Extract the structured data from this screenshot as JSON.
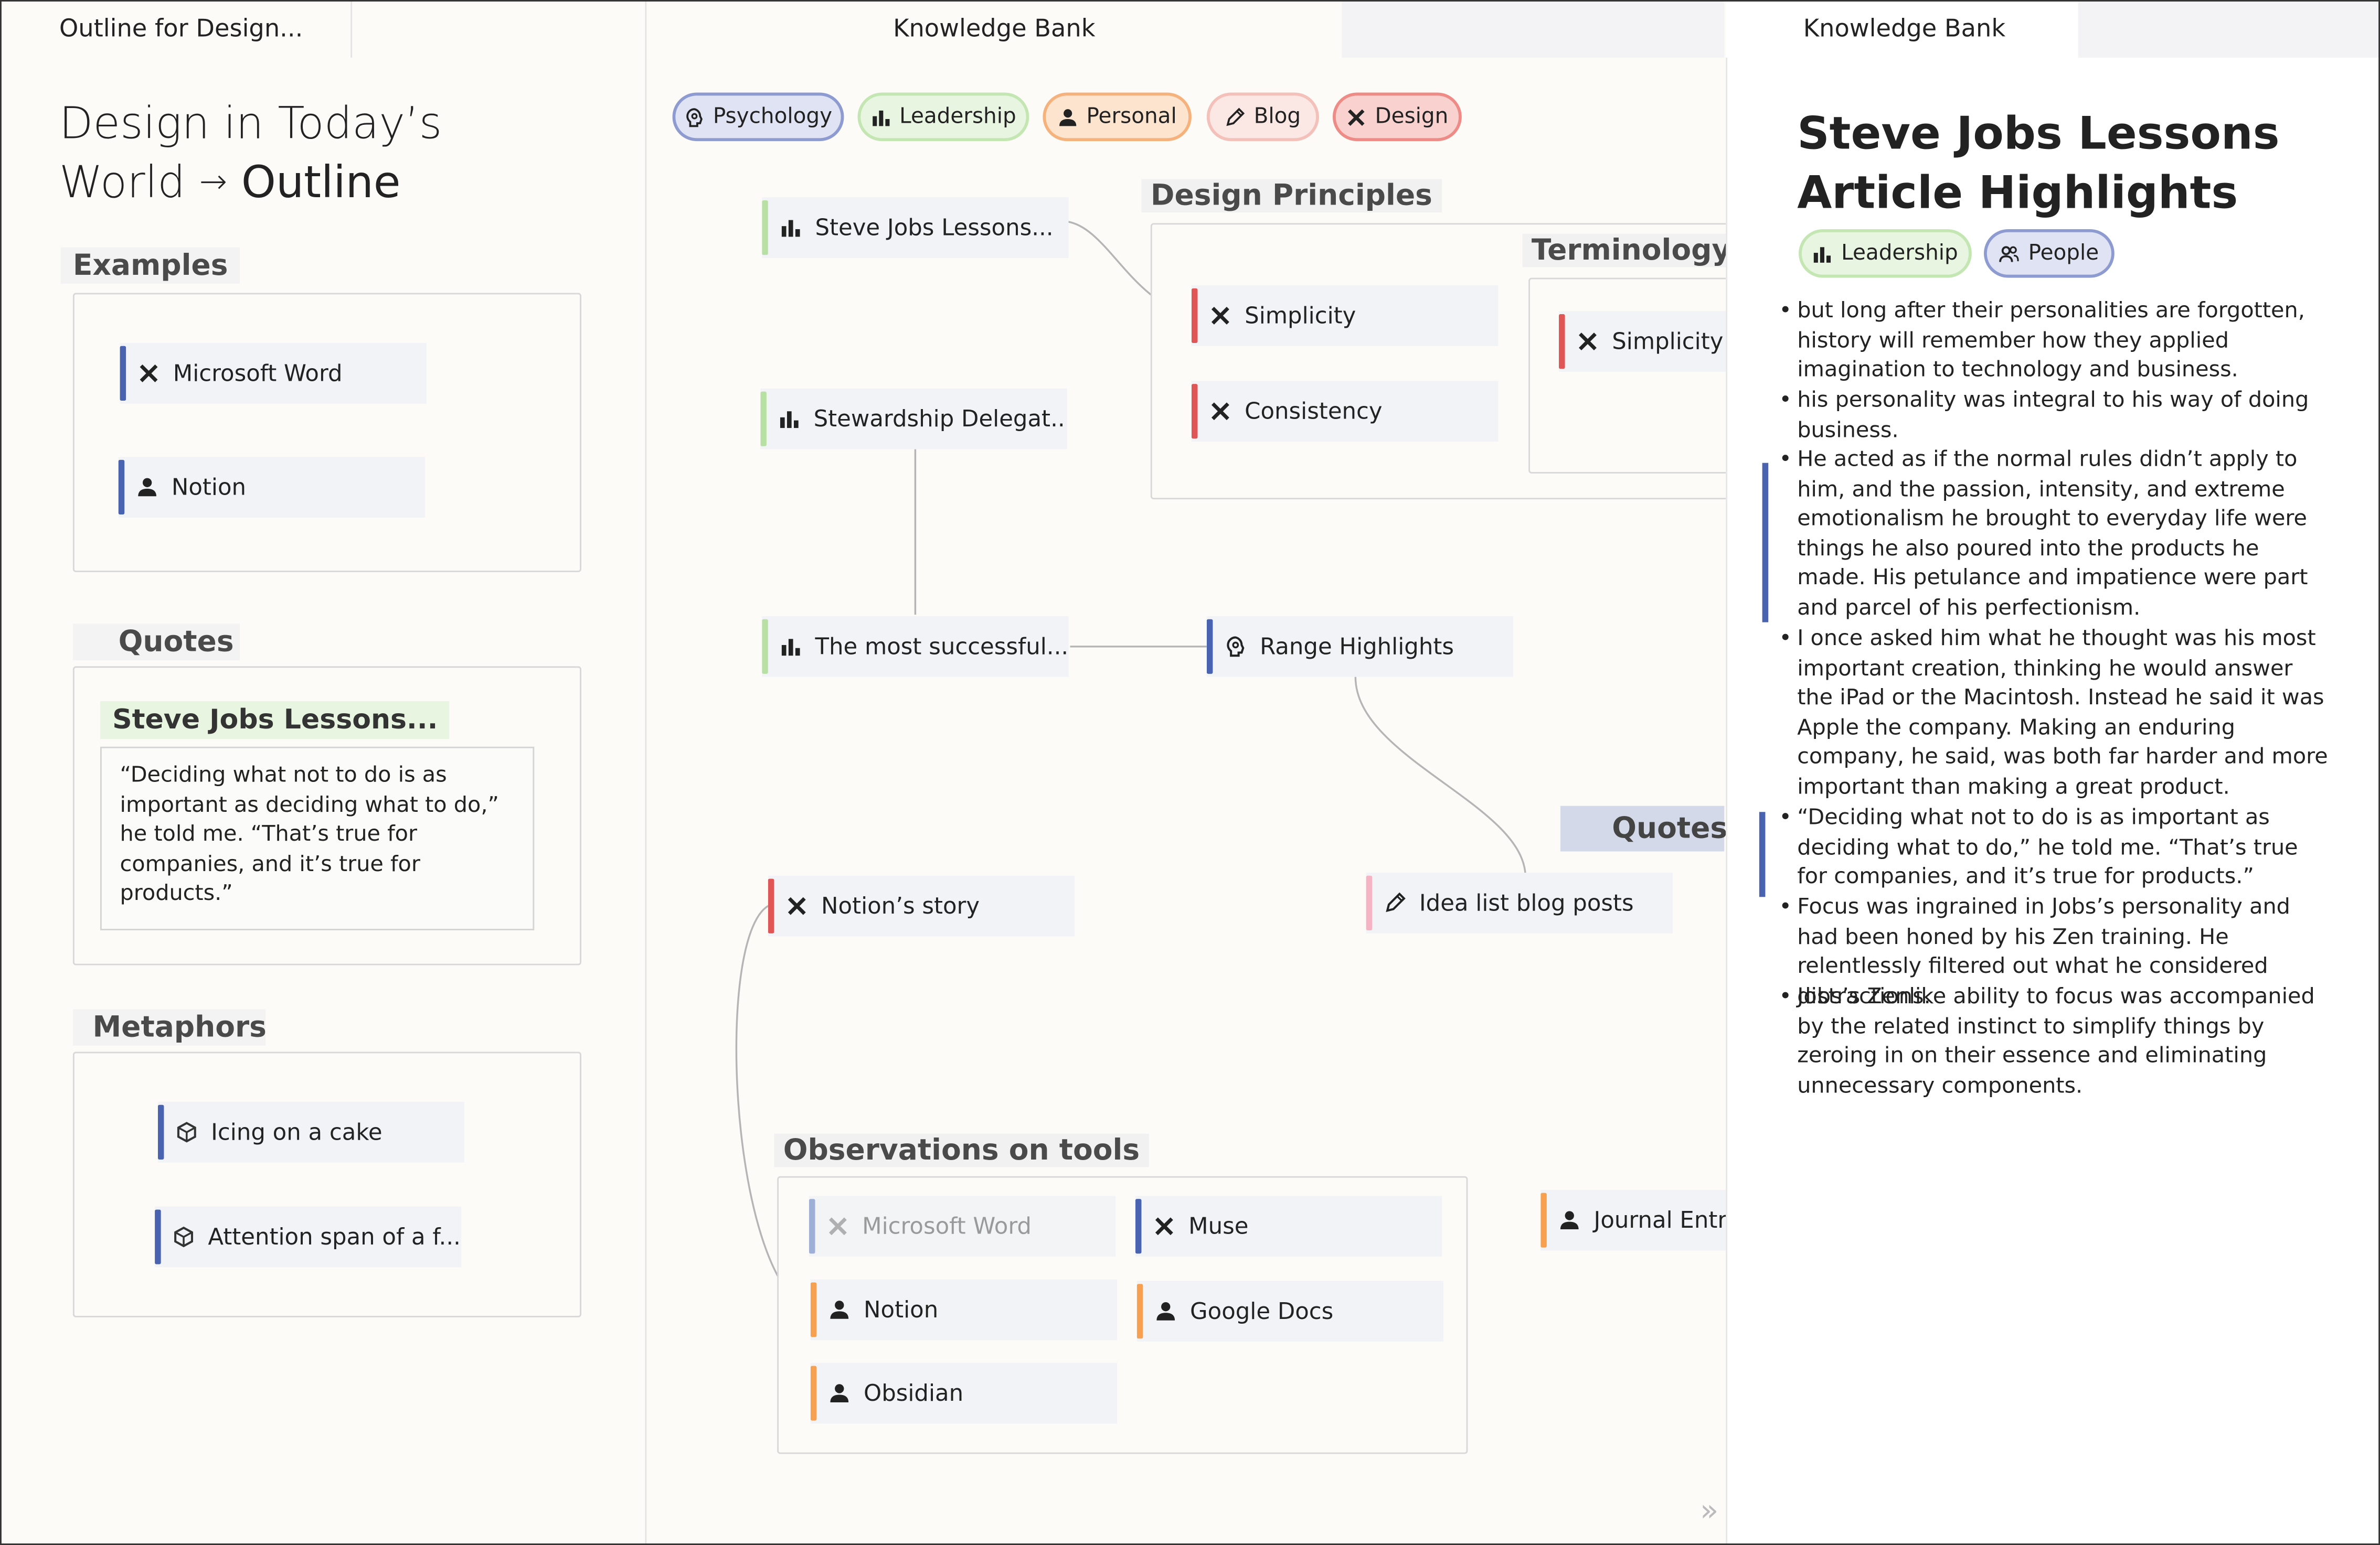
{
  "left_panel": {
    "tab_title": "Outline for Design...",
    "heading_line1": "Design in Today’s",
    "heading_line2_prefix": "World",
    "heading_arrow": "→",
    "heading_bold": "Outline",
    "sections": [
      {
        "label": "Examples",
        "items": [
          {
            "label": "Microsoft Word",
            "icon": "design-tools-icon"
          },
          {
            "label": "Notion",
            "icon": "person-icon"
          }
        ]
      },
      {
        "label": "Quotes",
        "source_title": "Steve Jobs Lessons...",
        "quote": "“Deciding what not to do is as important as deciding what to do,” he told me. “That’s true for companies, and it’s true for products.”"
      },
      {
        "label": "Metaphors",
        "items": [
          {
            "label": "Icing on a cake",
            "icon": "cube-icon"
          },
          {
            "label": "Attention span of a f...",
            "icon": "cube-icon"
          }
        ]
      }
    ]
  },
  "middle_panel": {
    "tab_title": "Knowledge Bank",
    "filters": [
      {
        "label": "Psychology",
        "icon": "brain-icon",
        "bg": "#dfe3f3",
        "border": "#8e9bd0"
      },
      {
        "label": "Leadership",
        "icon": "bar-chart-icon",
        "bg": "#e8f6e1",
        "border": "#bfe3ae"
      },
      {
        "label": "Personal",
        "icon": "person-icon",
        "bg": "#fde4cf",
        "border": "#f6b27c"
      },
      {
        "label": "Blog",
        "icon": "pencil-icon",
        "bg": "#fbe3e0",
        "border": "#f4c0ba"
      },
      {
        "label": "Design",
        "icon": "design-tools-icon",
        "bg": "#f9d2d0",
        "border": "#ee8b86"
      }
    ],
    "nodes": {
      "steve": "Steve Jobs Lessons...",
      "stewardship": "Stewardship Delegat...",
      "most_successful": "The most successful...",
      "range": "Range Highlights",
      "notions_story": "Notion’s story",
      "idea_list": "Idea list blog posts",
      "journal": "Journal Entr"
    },
    "design_principles": {
      "label": "Design Principles",
      "items": [
        "Simplicity",
        "Consistency"
      ]
    },
    "terminology": {
      "label": "Terminology",
      "items": [
        "Simplicity"
      ]
    },
    "quotes_label": "Quotes",
    "observations": {
      "label": "Observations on tools",
      "items": [
        "Microsoft Word",
        "Muse",
        "Notion",
        "Google Docs",
        "Obsidian"
      ]
    },
    "expand_glyph": "»"
  },
  "right_panel": {
    "tab_title": "Knowledge Bank",
    "title_line1": "Steve Jobs Lessons",
    "title_line2": "Article Highlights",
    "tags": [
      {
        "label": "Leadership",
        "icon": "bar-chart-icon"
      },
      {
        "label": "People",
        "icon": "people-icon"
      }
    ],
    "bullets": [
      "but long after their personalities are forgotten, history will remember how they applied imagination to technology and business.",
      "his personality was integral to his way of doing business.",
      "He acted as if the normal rules didn’t apply to him, and the passion, intensity, and extreme emotionalism he brought to everyday life were things he also poured into the products he made. His petulance and impatience were part and parcel of his perfectionism.",
      "I once asked him what he thought was his most important creation, thinking he would answer the iPad or the Macintosh. Instead he said it was Apple the company. Making an enduring company, he said, was both far harder and more important than making a great product.",
      "“Deciding what not to do is as important as deciding what to do,” he told me. “That’s true for companies, and it’s true for products.”",
      "Focus was ingrained in Jobs’s personality and had been honed by his Zen training. He relentlessly filtered out what he considered distractions.",
      "Jobs’s Zenlike ability to focus was accompanied by the related instinct to simplify things by zeroing in on their essence and eliminating unnecessary components."
    ],
    "bullet_glyph": "•"
  },
  "colors": {
    "blue": "#4a63b0",
    "red": "#e05555",
    "green": "#b8e0a5",
    "orange": "#f7a04f",
    "pink": "#f4b4c4",
    "light_blue": "#9fb0d8"
  }
}
